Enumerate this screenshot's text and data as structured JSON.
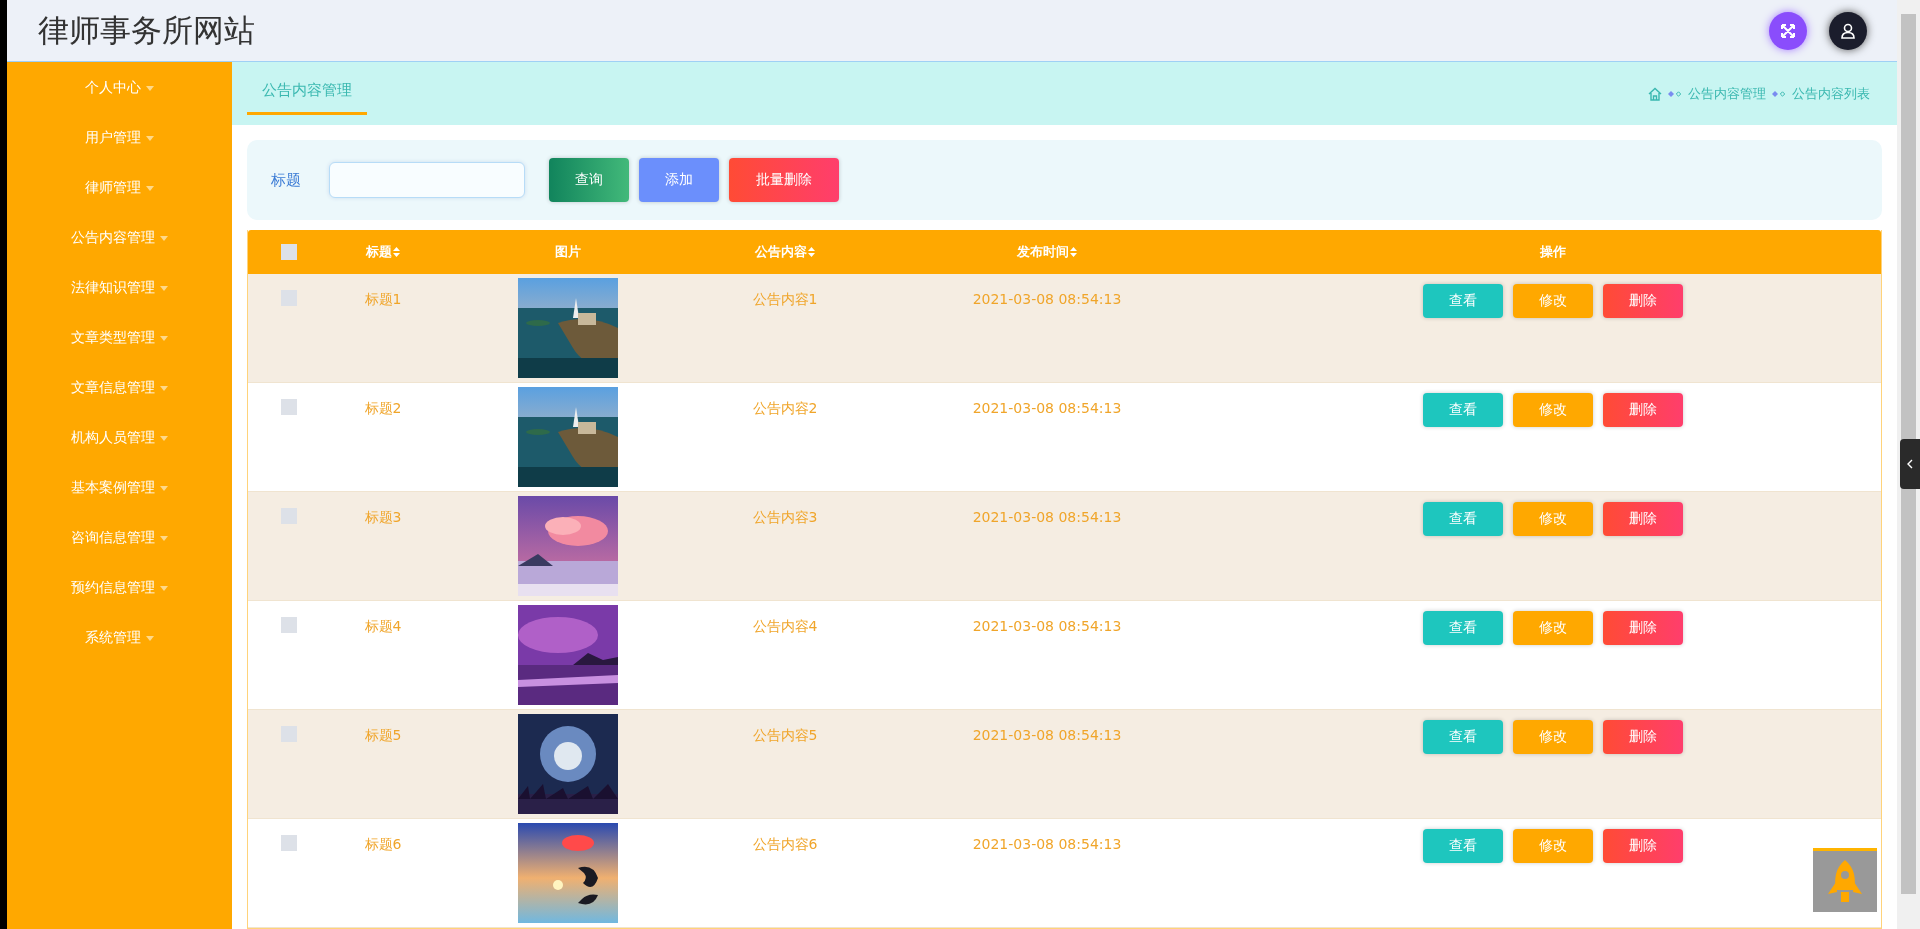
{
  "header": {
    "title": "律师事务所网站"
  },
  "sidebar": {
    "items": [
      {
        "label": "个人中心"
      },
      {
        "label": "用户管理"
      },
      {
        "label": "律师管理"
      },
      {
        "label": "公告内容管理"
      },
      {
        "label": "法律知识管理"
      },
      {
        "label": "文章类型管理"
      },
      {
        "label": "文章信息管理"
      },
      {
        "label": "机构人员管理"
      },
      {
        "label": "基本案例管理"
      },
      {
        "label": "咨询信息管理"
      },
      {
        "label": "预约信息管理"
      },
      {
        "label": "系统管理"
      }
    ]
  },
  "tab_bar": {
    "tabs": [
      {
        "label": "公告内容管理",
        "selected": true
      }
    ],
    "breadcrumb": [
      "公告内容管理",
      "公告内容列表"
    ]
  },
  "search": {
    "label": "标题",
    "buttons": [
      {
        "kind": "query",
        "label": "查询"
      },
      {
        "kind": "add",
        "label": "添加"
      },
      {
        "kind": "delete",
        "label": "批量删除"
      }
    ]
  },
  "table": {
    "select_all": {
      "checked": false
    },
    "columns": [
      {
        "label": "标题",
        "sortable": true
      },
      {
        "label": "图片",
        "sortable": false
      },
      {
        "label": "公告内容",
        "sortable": true
      },
      {
        "label": "发布时间",
        "sortable": true
      },
      {
        "label": "操作",
        "sortable": false
      }
    ],
    "rows": [
      {
        "checked": false,
        "title": "标题1",
        "content": "公告内容1",
        "time": "2021-03-08 08:54:13",
        "actions": [
          {
            "kind": "view",
            "label": "查看"
          },
          {
            "kind": "edit",
            "label": "修改"
          },
          {
            "kind": "delete",
            "label": "删除"
          }
        ]
      },
      {
        "checked": false,
        "title": "标题2",
        "content": "公告内容2",
        "time": "2021-03-08 08:54:13",
        "actions": [
          {
            "kind": "view",
            "label": "查看"
          },
          {
            "kind": "edit",
            "label": "修改"
          },
          {
            "kind": "delete",
            "label": "删除"
          }
        ]
      },
      {
        "checked": false,
        "title": "标题3",
        "content": "公告内容3",
        "time": "2021-03-08 08:54:13",
        "actions": [
          {
            "kind": "view",
            "label": "查看"
          },
          {
            "kind": "edit",
            "label": "修改"
          },
          {
            "kind": "delete",
            "label": "删除"
          }
        ]
      },
      {
        "checked": false,
        "title": "标题4",
        "content": "公告内容4",
        "time": "2021-03-08 08:54:13",
        "actions": [
          {
            "kind": "view",
            "label": "查看"
          },
          {
            "kind": "edit",
            "label": "修改"
          },
          {
            "kind": "delete",
            "label": "删除"
          }
        ]
      },
      {
        "checked": false,
        "title": "标题5",
        "content": "公告内容5",
        "time": "2021-03-08 08:54:13",
        "actions": [
          {
            "kind": "view",
            "label": "查看"
          },
          {
            "kind": "edit",
            "label": "修改"
          },
          {
            "kind": "delete",
            "label": "删除"
          }
        ]
      },
      {
        "checked": false,
        "title": "标题6",
        "content": "公告内容6",
        "time": "2021-03-08 08:54:13",
        "actions": [
          {
            "kind": "view",
            "label": "查看"
          },
          {
            "kind": "edit",
            "label": "修改"
          },
          {
            "kind": "delete",
            "label": "删除"
          }
        ]
      }
    ]
  }
}
